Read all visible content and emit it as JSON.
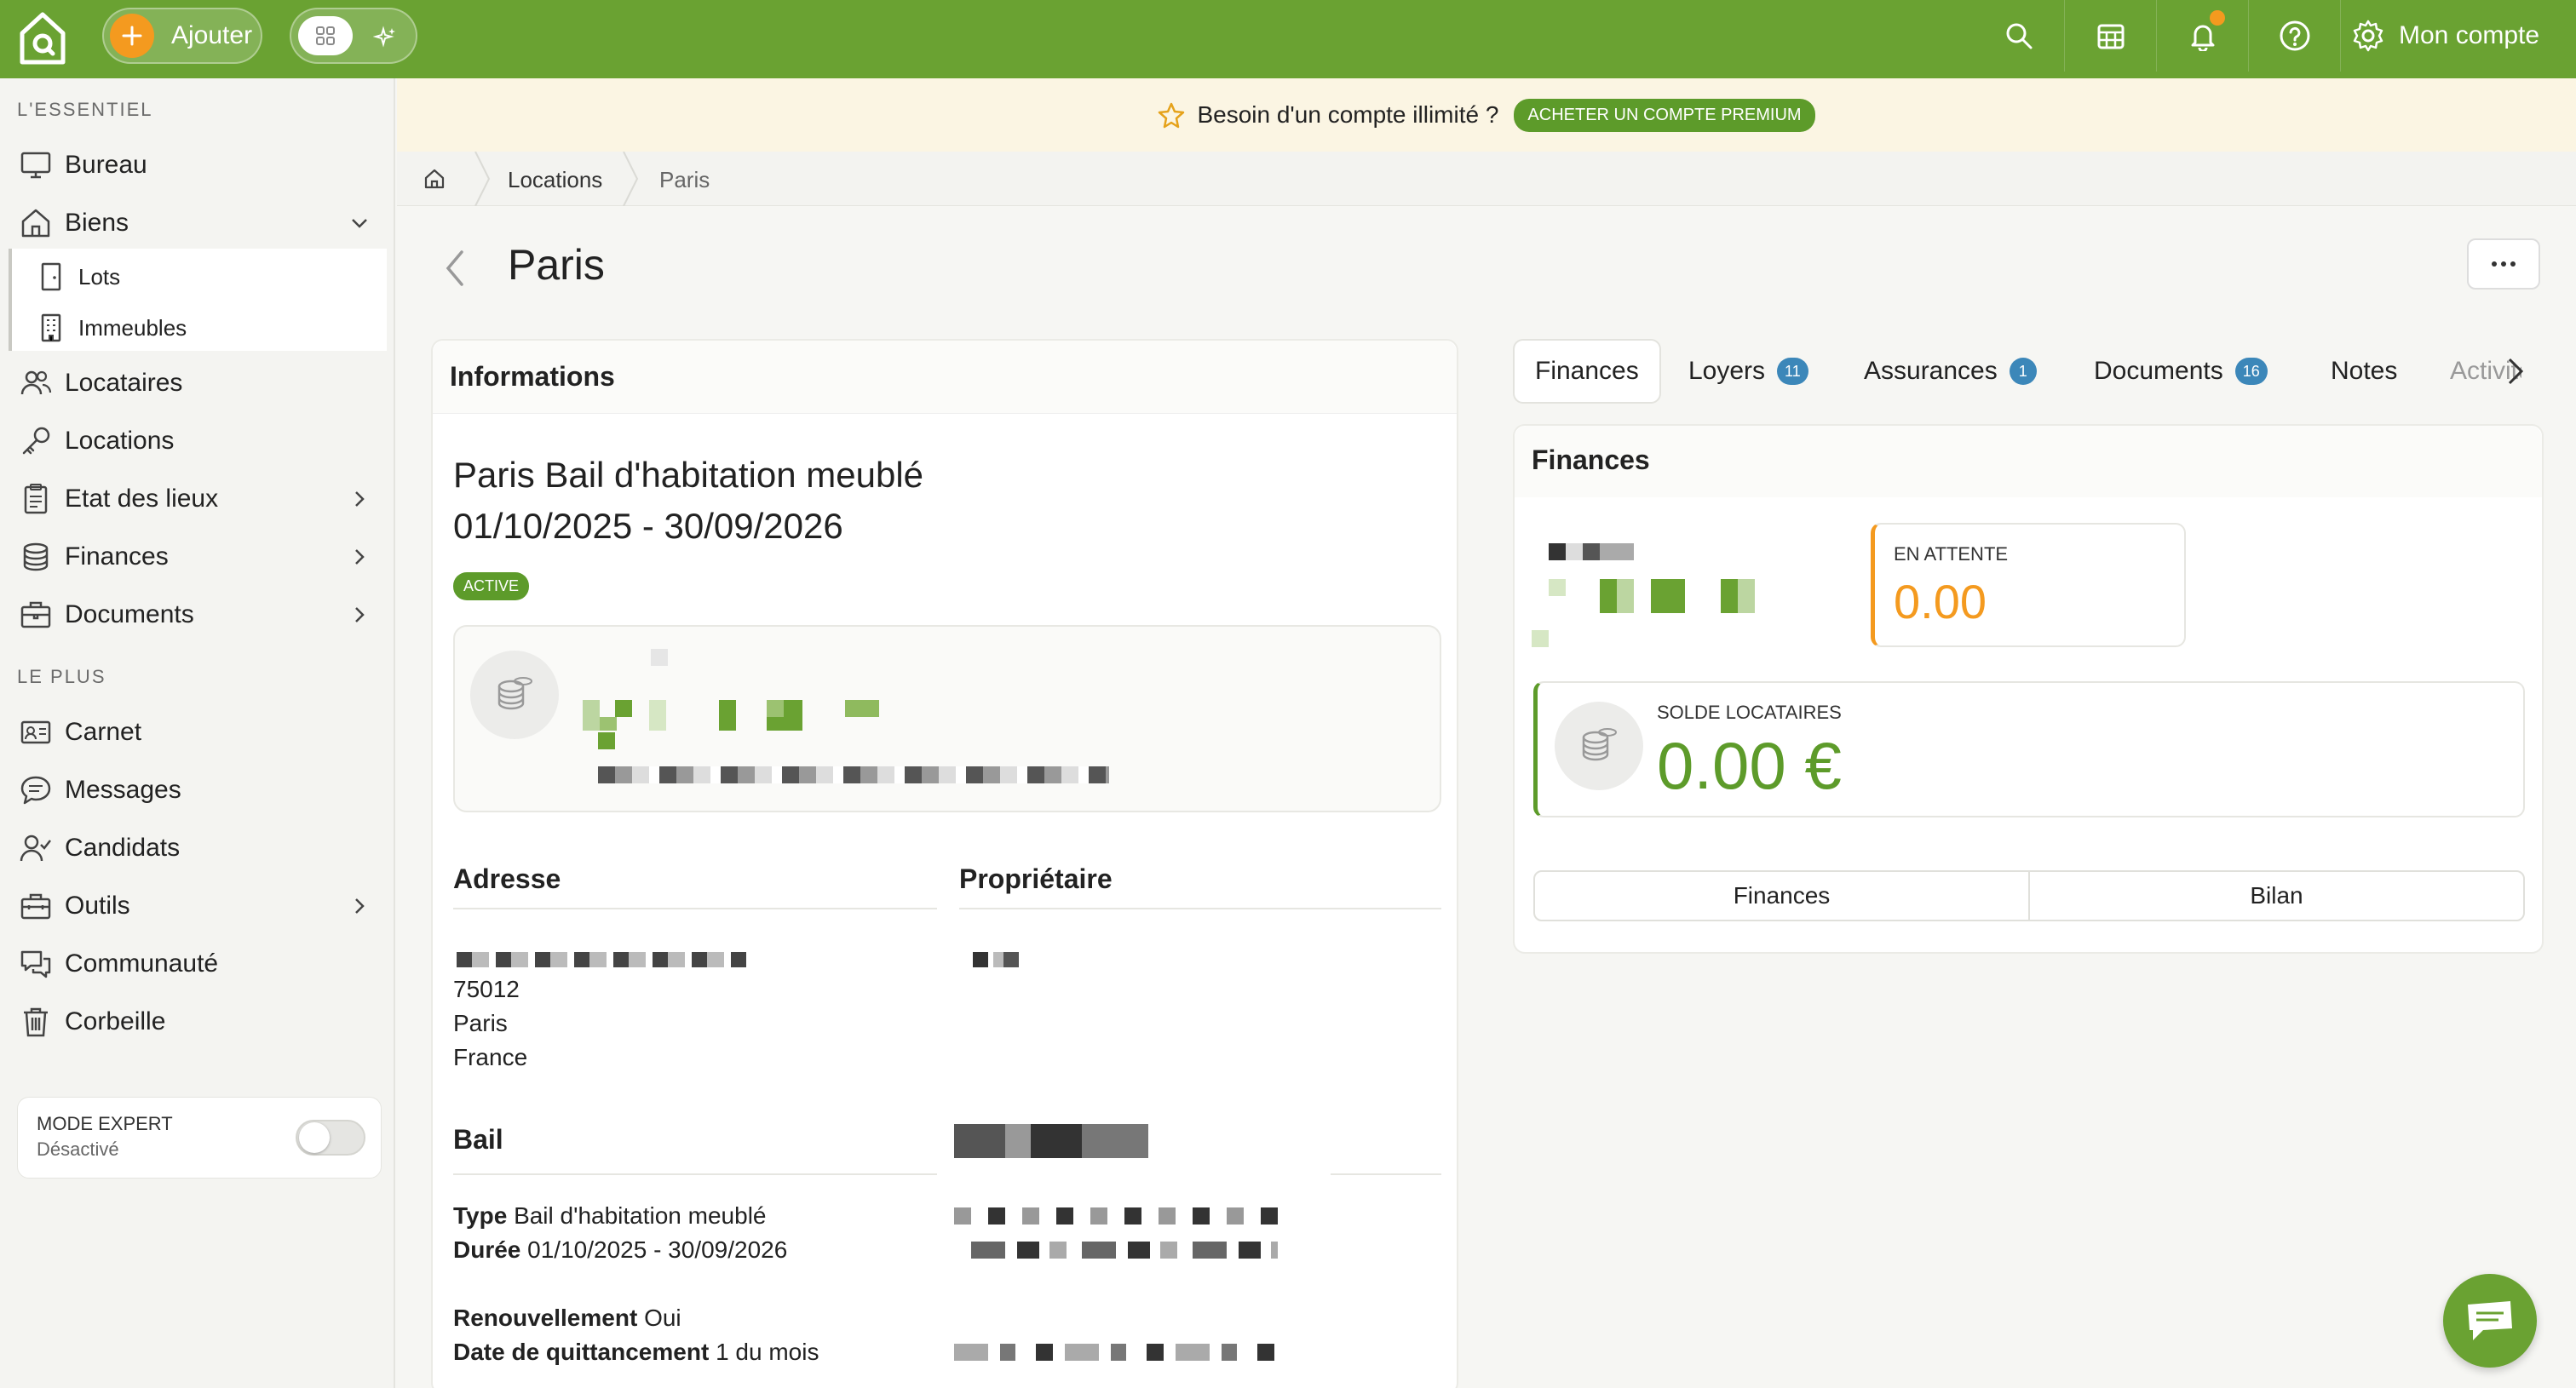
{
  "topbar": {
    "add_label": "Ajouter",
    "account_label": "Mon compte",
    "icons": [
      "search-icon",
      "calendar-icon",
      "bell-icon",
      "help-icon",
      "gear-icon"
    ],
    "brand_color": "#6aa232",
    "accent_color": "#f49a1f"
  },
  "sidebar": {
    "section_essentiel": "L'ESSENTIEL",
    "section_plus": "LE PLUS",
    "items": {
      "bureau": "Bureau",
      "biens": "Biens",
      "lots": "Lots",
      "immeubles": "Immeubles",
      "locataires": "Locataires",
      "locations": "Locations",
      "etat_des_lieux": "Etat des lieux",
      "finances": "Finances",
      "documents": "Documents",
      "carnet": "Carnet",
      "messages": "Messages",
      "candidats": "Candidats",
      "outils": "Outils",
      "communaute": "Communauté",
      "corbeille": "Corbeille"
    },
    "expert_mode": {
      "title": "MODE EXPERT",
      "status": "Désactivé"
    }
  },
  "promo": {
    "text": "Besoin d'un compte illimité ?",
    "button": "ACHETER UN COMPTE PREMIUM"
  },
  "breadcrumb": {
    "items": [
      "Locations",
      "Paris"
    ]
  },
  "page": {
    "title": "Paris"
  },
  "info": {
    "header": "Informations",
    "lease_title": "Paris Bail d'habitation meublé",
    "lease_dates": "01/10/2025 - 30/09/2026",
    "status_badge": "ACTIVE",
    "address_title": "Adresse",
    "owner_title": "Propriétaire",
    "address_lines": [
      "75012",
      "Paris",
      "France"
    ],
    "bail_title": "Bail",
    "type_label": "Type",
    "type_value": "Bail d'habitation meublé",
    "duree_label": "Durée",
    "duree_value": "01/10/2025 - 30/09/2026",
    "renouvellement_label": "Renouvellement",
    "renouvellement_value": "Oui",
    "quittancement_label": "Date de quittancement",
    "quittancement_value": "1 du mois"
  },
  "tabs": [
    {
      "label": "Finances"
    },
    {
      "label": "Loyers",
      "count": "11"
    },
    {
      "label": "Assurances",
      "count": "1"
    },
    {
      "label": "Documents",
      "count": "16"
    },
    {
      "label": "Notes"
    },
    {
      "label": "Activité"
    }
  ],
  "finances": {
    "header": "Finances",
    "pending_label": "EN ATTENTE",
    "pending_value": "0.00",
    "balance_label": "SOLDE LOCATAIRES",
    "balance_value": "0.00 €",
    "segment_finances": "Finances",
    "segment_bilan": "Bilan"
  }
}
